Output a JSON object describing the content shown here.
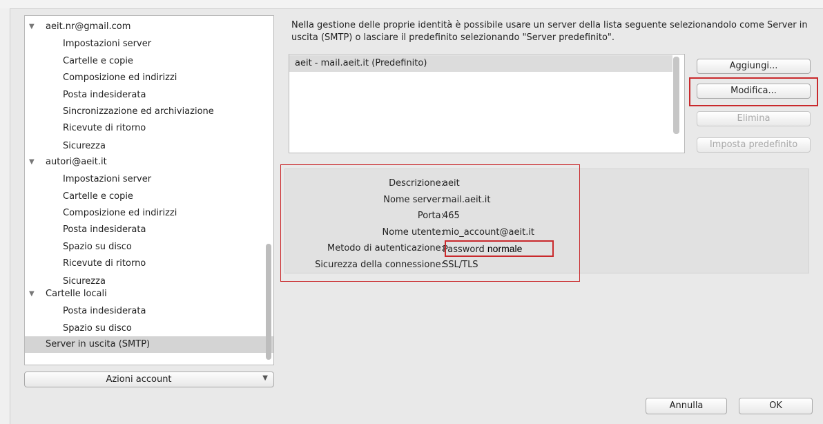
{
  "sidebar": {
    "items": [
      {
        "label": "aeit.nr@gmail.com",
        "level": 0,
        "expanded": true
      },
      {
        "label": "Impostazioni server",
        "level": 1
      },
      {
        "label": "Cartelle e copie",
        "level": 1
      },
      {
        "label": "Composizione ed indirizzi",
        "level": 1
      },
      {
        "label": "Posta indesiderata",
        "level": 1
      },
      {
        "label": "Sincronizzazione ed archiviazione",
        "level": 1
      },
      {
        "label": "Ricevute di ritorno",
        "level": 1
      },
      {
        "label": "Sicurezza",
        "level": 1
      },
      {
        "label": "autori@aeit.it",
        "level": 0,
        "expanded": true
      },
      {
        "label": "Impostazioni server",
        "level": 1
      },
      {
        "label": "Cartelle e copie",
        "level": 1
      },
      {
        "label": "Composizione ed indirizzi",
        "level": 1
      },
      {
        "label": "Posta indesiderata",
        "level": 1
      },
      {
        "label": "Spazio su disco",
        "level": 1
      },
      {
        "label": "Ricevute di ritorno",
        "level": 1
      },
      {
        "label": "Sicurezza",
        "level": 1
      },
      {
        "label": "Cartelle locali",
        "level": 0,
        "expanded": true
      },
      {
        "label": "Posta indesiderata",
        "level": 1
      },
      {
        "label": "Spazio su disco",
        "level": 1
      },
      {
        "label": "Server in uscita (SMTP)",
        "level": 0,
        "selected": true
      }
    ],
    "actions_label": "Azioni account"
  },
  "description": "Nella gestione delle proprie identità è possibile usare un server della lista seguente selezionandolo come Server in uscita (SMTP) o lasciare il predefinito selezionando \"Server predefinito\".",
  "server_list": {
    "items": [
      "aeit - mail.aeit.it (Predefinito)"
    ]
  },
  "buttons": {
    "add": "Aggiungi...",
    "edit": "Modifica...",
    "delete": "Elimina",
    "set_default": "Imposta predefinito",
    "cancel": "Annulla",
    "ok": "OK"
  },
  "details": [
    {
      "key": "Descrizione:",
      "value": "aeit"
    },
    {
      "key": "Nome server:",
      "value": "mail.aeit.it"
    },
    {
      "key": "Porta:",
      "value": "465"
    },
    {
      "key": "Nome utente:",
      "value": "mio_account@aeit.it"
    },
    {
      "key": "Metodo di autenticazione:",
      "value": "Password",
      "value_extra": "normale"
    },
    {
      "key": "Sicurezza della connessione:",
      "value": "SSL/TLS"
    }
  ],
  "colors": {
    "highlight": "#c9292c",
    "selection": "#d4d4d4"
  }
}
